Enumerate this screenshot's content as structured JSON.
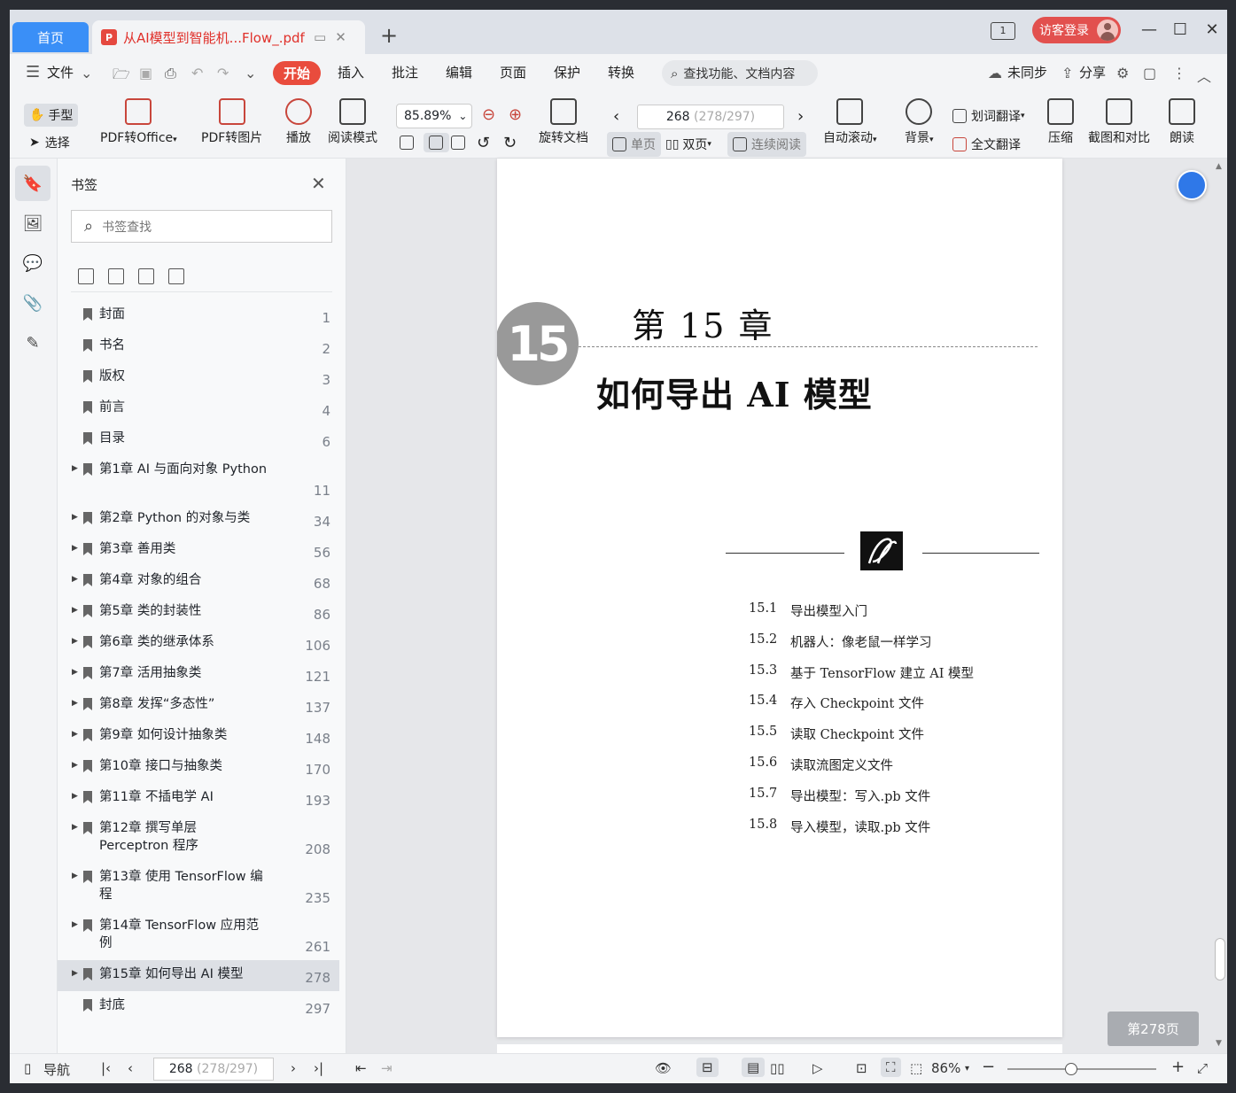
{
  "titlebar": {
    "home_tab": "首页",
    "doc_tab": "从AI模型到智能机...Flow_.pdf",
    "pages_badge": "1",
    "login": "访客登录"
  },
  "menubar": {
    "file": "文件",
    "tabs": [
      "开始",
      "插入",
      "批注",
      "编辑",
      "页面",
      "保护",
      "转换"
    ],
    "search_placeholder": "查找功能、文档内容",
    "sync": "未同步",
    "share": "分享"
  },
  "ribbon": {
    "hand": "手型",
    "select": "选择",
    "pdf_to_office": "PDF转Office",
    "pdf_to_image": "PDF转图片",
    "play": "播放",
    "read_mode": "阅读模式",
    "zoom": "85.89%",
    "rotate_doc": "旋转文档",
    "page_current": "268",
    "page_total": "(278/297)",
    "single": "单页",
    "double": "双页",
    "continuous": "连续阅读",
    "auto_scroll": "自动滚动",
    "background": "背景",
    "word_translate": "划词翻译",
    "full_translate": "全文翻译",
    "compress": "压缩",
    "screenshot": "截图和对比",
    "read_aloud": "朗读"
  },
  "bookmarks": {
    "title": "书签",
    "search_placeholder": "书签查找",
    "items": [
      {
        "label": "封面",
        "page": "1"
      },
      {
        "label": "书名",
        "page": "2"
      },
      {
        "label": "版权",
        "page": "3"
      },
      {
        "label": "前言",
        "page": "4"
      },
      {
        "label": "目录",
        "page": "6"
      },
      {
        "label": "第1章 AI 与面向对象 Python",
        "page": "11"
      },
      {
        "label": "第2章 Python 的对象与类",
        "page": "34"
      },
      {
        "label": "第3章 善用类",
        "page": "56"
      },
      {
        "label": "第4章 对象的组合",
        "page": "68"
      },
      {
        "label": "第5章 类的封装性",
        "page": "86"
      },
      {
        "label": "第6章 类的继承体系",
        "page": "106"
      },
      {
        "label": "第7章 活用抽象类",
        "page": "121"
      },
      {
        "label": "第8章 发挥“多态性”",
        "page": "137"
      },
      {
        "label": "第9章 如何设计抽象类",
        "page": "148"
      },
      {
        "label": "第10章 接口与抽象类",
        "page": "170"
      },
      {
        "label": "第11章 不插电学 AI",
        "page": "193"
      },
      {
        "label": "第12章 撰写单层 Perceptron 程序",
        "page": "208"
      },
      {
        "label": "第13章 使用 TensorFlow 编程",
        "page": "235"
      },
      {
        "label": "第14章 TensorFlow 应用范例",
        "page": "261"
      },
      {
        "label": "第15章 如何导出 AI 模型",
        "page": "278"
      },
      {
        "label": "封底",
        "page": "297"
      }
    ]
  },
  "document": {
    "chapter_heading": "第 15 章",
    "chapter_badge": "15",
    "chapter_title": "如何导出 AI 模型",
    "toc": [
      {
        "num": "15.1",
        "title": "导出模型入门"
      },
      {
        "num": "15.2",
        "title": "机器人：像老鼠一样学习"
      },
      {
        "num": "15.3",
        "title": "基于 TensorFlow 建立 AI 模型"
      },
      {
        "num": "15.4",
        "title": "存入 Checkpoint 文件"
      },
      {
        "num": "15.5",
        "title": "读取 Checkpoint 文件"
      },
      {
        "num": "15.6",
        "title": "读取流图定义文件"
      },
      {
        "num": "15.7",
        "title": "导出模型：写入.pb 文件"
      },
      {
        "num": "15.8",
        "title": "导入模型，读取.pb 文件"
      }
    ],
    "page_indicator": "第278页"
  },
  "statusbar": {
    "nav": "导航",
    "page_current": "268",
    "page_total": "(278/297)",
    "zoom": "86%",
    "zoom_fraction": 0.43
  }
}
